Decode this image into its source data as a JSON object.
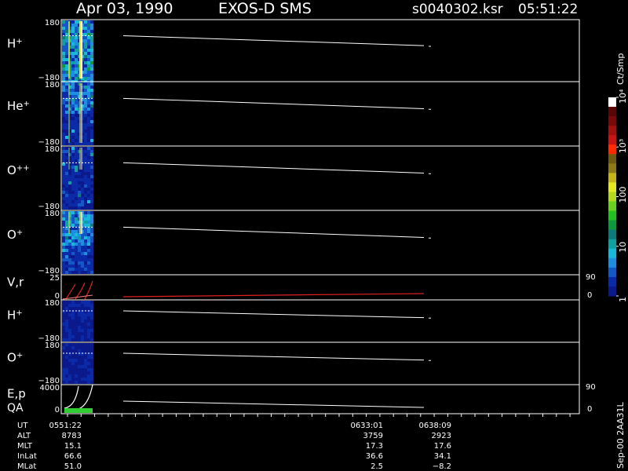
{
  "header": {
    "date": "Apr 03, 1990",
    "instrument": "EXOS-D SMS",
    "file": "s0040302.ksr",
    "time": "05:51:22"
  },
  "colorbar": {
    "unit": "Ct/Smp",
    "tick_labels": [
      "1",
      "10",
      "100",
      "10³",
      "10⁴"
    ],
    "colors": [
      "#0a1a8c",
      "#0a2aa8",
      "#1458c8",
      "#1e8ee0",
      "#18b8d8",
      "#10a0a0",
      "#0c7a7a",
      "#0c9a3c",
      "#22c022",
      "#6ad21e",
      "#b4d81e",
      "#e8e81e",
      "#c8b418",
      "#8c7a14",
      "#6e5a10",
      "#ff2a00",
      "#c81414",
      "#a01010",
      "#7a0a0a",
      "#5a0606",
      "#ffffff"
    ]
  },
  "footer_version": "Sep-00 2AA31L",
  "panels": [
    {
      "label": "H+",
      "top": "180",
      "bottom": "−180",
      "ion": "H",
      "charge": "+"
    },
    {
      "label": "He+",
      "top": "180",
      "bottom": "−180",
      "ion": "He",
      "charge": "+"
    },
    {
      "label": "O++",
      "top": "180",
      "bottom": "−180",
      "ion": "O",
      "charge": "++"
    },
    {
      "label": "O+",
      "top": "180",
      "bottom": "−180",
      "ion": "O",
      "charge": "+"
    },
    {
      "label": "V,r",
      "top": "25",
      "bottom": "0",
      "right_top": "90",
      "right_bottom": "0"
    },
    {
      "label": "H+",
      "top": "180",
      "bottom": "−180",
      "ion": "H",
      "charge": "+"
    },
    {
      "label": "O+",
      "top": "180",
      "bottom": "−180",
      "ion": "O",
      "charge": "+"
    },
    {
      "label": "E,p",
      "label2": "QA",
      "top": "4000",
      "bottom": "0",
      "right_top": "90",
      "right_bottom": "0"
    }
  ],
  "ephemeris": {
    "row_labels": [
      "UT",
      "ALT",
      "MLT",
      "InLat",
      "MLat"
    ],
    "columns": [
      {
        "values": [
          "0551:22",
          "8783",
          "15.1",
          "66.6",
          "51.0"
        ]
      },
      {
        "values": [
          "0633:01",
          "3759",
          "17.3",
          "36.6",
          "2.5"
        ]
      },
      {
        "values": [
          "0638:09",
          "2923",
          "17.6",
          "34.1",
          "−8.2"
        ]
      }
    ]
  },
  "chart_data": {
    "type": "heatmap",
    "title": "Apr 03, 1990 EXOS-D SMS",
    "x_time_ticks": [
      "0551:22",
      "0633:01",
      "0638:09"
    ],
    "panels": [
      {
        "name": "H+",
        "ylim": [
          -180,
          180
        ]
      },
      {
        "name": "He+",
        "ylim": [
          -180,
          180
        ]
      },
      {
        "name": "O++",
        "ylim": [
          -180,
          180
        ]
      },
      {
        "name": "O+",
        "ylim": [
          -180,
          180
        ]
      },
      {
        "name": "V,r",
        "ylim": [
          0,
          25
        ],
        "right_ylim": [
          0,
          90
        ]
      },
      {
        "name": "H+",
        "ylim": [
          -180,
          180
        ]
      },
      {
        "name": "O+",
        "ylim": [
          -180,
          180
        ]
      },
      {
        "name": "E,p",
        "ylim": [
          0,
          4000
        ],
        "right_ylim": [
          0,
          90
        ]
      }
    ],
    "colorbar_range": [
      1,
      10000
    ],
    "colorbar_scale": "log",
    "colorbar_label": "Ct/Smp"
  }
}
